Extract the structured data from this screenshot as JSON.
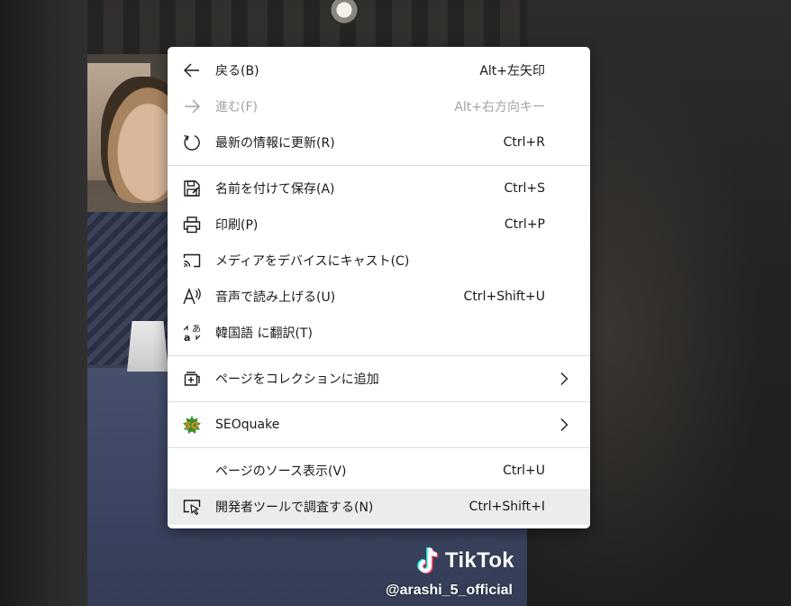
{
  "video": {
    "brand": "TikTok",
    "username": "@arashi_5_official"
  },
  "menu": {
    "items": [
      {
        "label": "戻る(B)",
        "shortcut": "Alt+左矢印",
        "icon": "arrow-left-icon"
      },
      {
        "label": "進む(F)",
        "shortcut": "Alt+右方向キー",
        "icon": "arrow-right-icon",
        "disabled": true
      },
      {
        "label": "最新の情報に更新(R)",
        "shortcut": "Ctrl+R",
        "icon": "refresh-icon"
      },
      {
        "label": "名前を付けて保存(A)",
        "shortcut": "Ctrl+S",
        "icon": "save-icon"
      },
      {
        "label": "印刷(P)",
        "shortcut": "Ctrl+P",
        "icon": "print-icon"
      },
      {
        "label": "メディアをデバイスにキャスト(C)",
        "shortcut": "",
        "icon": "cast-icon"
      },
      {
        "label": "音声で読み上げる(U)",
        "shortcut": "Ctrl+Shift+U",
        "icon": "read-aloud-icon"
      },
      {
        "label": "韓国語 に翻訳(T)",
        "shortcut": "",
        "icon": "translate-icon"
      },
      {
        "label": "ページをコレクションに追加",
        "shortcut": "",
        "icon": "collections-icon",
        "submenu": true
      },
      {
        "label": "SEOquake",
        "shortcut": "",
        "icon": "seoquake-icon",
        "submenu": true
      },
      {
        "label": "ページのソース表示(V)",
        "shortcut": "Ctrl+U",
        "icon": ""
      },
      {
        "label": "開発者ツールで調査する(N)",
        "shortcut": "Ctrl+Shift+I",
        "icon": "inspect-icon",
        "highlighted": true
      }
    ]
  },
  "colors": {
    "menu_bg": "#ffffff",
    "text": "#1a1a1a",
    "disabled_text": "#a3a3a3",
    "highlight_bg": "#ececec",
    "separator": "#dcdcdc",
    "seoquake_orange": "#f08a1c",
    "seoquake_green": "#3a8f2e"
  }
}
